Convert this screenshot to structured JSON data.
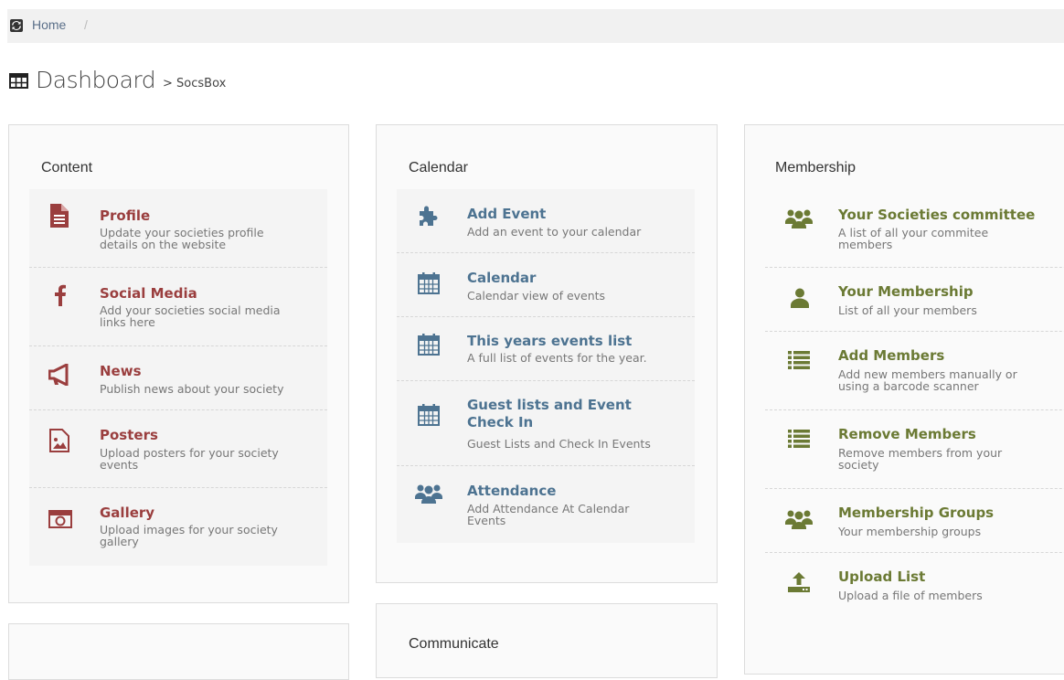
{
  "breadcrumb": {
    "home": "Home",
    "sep": "/"
  },
  "page": {
    "title": "Dashboard",
    "subtitle": "> SocsBox"
  },
  "colors": {
    "content_accent": "#9a3e3e",
    "calendar_accent": "#4d7391",
    "membership_accent": "#6b7a34"
  },
  "panels": {
    "content": {
      "title": "Content",
      "items": [
        {
          "title": "Profile",
          "desc": "Update your societies profile details on the website",
          "icon": "document-icon"
        },
        {
          "title": "Social Media",
          "desc": "Add your societies social media links here",
          "icon": "facebook-icon"
        },
        {
          "title": "News",
          "desc": "Publish news about your society",
          "icon": "megaphone-icon"
        },
        {
          "title": "Posters",
          "desc": "Upload posters for your society events",
          "icon": "picture-icon"
        },
        {
          "title": "Gallery",
          "desc": "Upload images for your society gallery",
          "icon": "camera-icon"
        }
      ]
    },
    "calendar": {
      "title": "Calendar",
      "items": [
        {
          "title": "Add Event",
          "desc": "Add an event to your calendar",
          "icon": "puzzle-icon"
        },
        {
          "title": "Calendar",
          "desc": "Calendar view of events",
          "icon": "calendar-icon"
        },
        {
          "title": "This years events list",
          "desc": "A full list of events for the year.",
          "icon": "calendar-icon"
        },
        {
          "title": "Guest lists and Event Check In",
          "desc": "Guest Lists and Check In Events",
          "icon": "calendar-icon"
        },
        {
          "title": "Attendance",
          "desc": "Add Attendance At Calendar Events",
          "icon": "group-icon"
        }
      ]
    },
    "membership": {
      "title": "Membership",
      "items": [
        {
          "title": "Your Societies committee",
          "desc": "A list of all your commitee members",
          "icon": "group-icon"
        },
        {
          "title": "Your Membership",
          "desc": "List of all your members",
          "icon": "user-icon"
        },
        {
          "title": "Add Members",
          "desc": "Add new members manually or using a barcode scanner",
          "icon": "list-icon"
        },
        {
          "title": "Remove Members",
          "desc": "Remove members from your society",
          "icon": "list-icon"
        },
        {
          "title": "Membership Groups",
          "desc": "Your membership groups",
          "icon": "group-icon"
        },
        {
          "title": "Upload List",
          "desc": "Upload a file of members",
          "icon": "upload-icon"
        }
      ]
    },
    "communicate": {
      "title": "Communicate"
    }
  }
}
